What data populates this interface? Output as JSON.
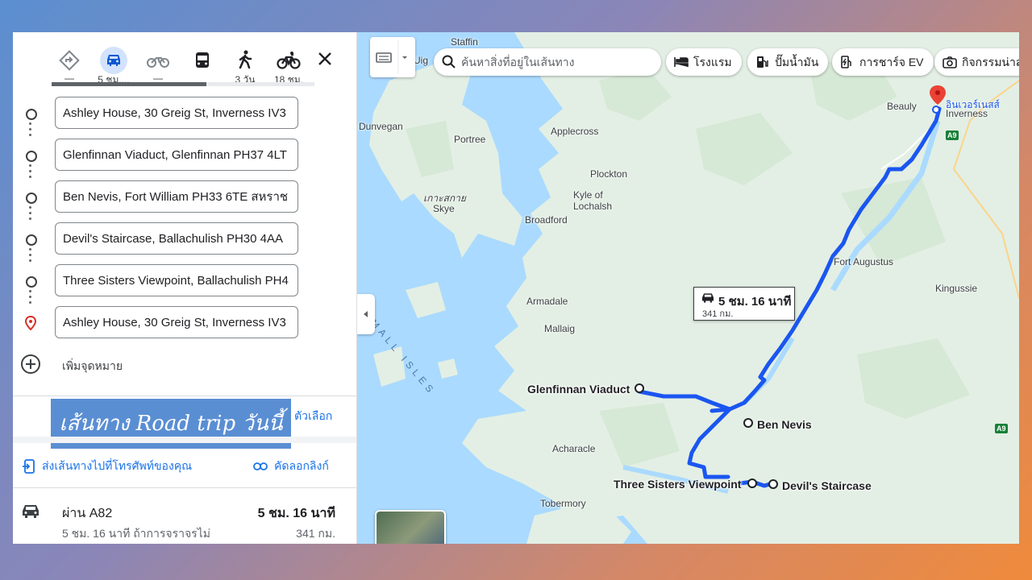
{
  "modes": [
    {
      "name": "best",
      "label": "—",
      "icon": "directions-icon"
    },
    {
      "name": "driving",
      "label": "5 ชม....",
      "icon": "car-icon",
      "active": true
    },
    {
      "name": "motorcycle",
      "label": "—",
      "icon": "motorcycle-icon"
    },
    {
      "name": "transit",
      "label": "",
      "icon": "bus-icon"
    },
    {
      "name": "walking",
      "label": "3 วัน",
      "icon": "walk-icon"
    },
    {
      "name": "cycling",
      "label": "18 ชม.",
      "icon": "bicycle-icon"
    }
  ],
  "stops": [
    "Ashley House, 30 Greig St, Inverness IV3",
    "Glenfinnan Viaduct, Glenfinnan PH37 4LT",
    "Ben Nevis, Fort William PH33 6TE สหราช",
    "Devil's Staircase, Ballachulish PH30 4AA",
    "Three Sisters Viewpoint, Ballachulish PH4",
    "Ashley House, 30 Greig St, Inverness IV3"
  ],
  "add_destination": "เพิ่มจุดหมาย",
  "options_label": "ตัวเลือก",
  "overlay_label": "เส้นทาง Road trip วันนี้",
  "send_to_phone": "ส่งเส้นทางไปที่โทรศัพท์ของคุณ",
  "copy_link": "คัดลอกลิงก์",
  "route": {
    "via": "ผ่าน A82",
    "time": "5 ชม. 16 นาที",
    "desc": "5 ชม. 16 นาที ถ้าการจราจรไม่",
    "distance": "341 กม."
  },
  "map": {
    "search_placeholder": "ค้นหาสิ่งที่อยู่ในเส้นทาง",
    "chips": [
      "โรงแรม",
      "ปั๊มน้ำมัน",
      "การชาร์จ EV",
      "กิจกรรมน่าส"
    ],
    "callout_time": "5 ชม. 16 นาที",
    "callout_dist": "341 กม.",
    "labels": {
      "staffin": "Staffin",
      "uig": "Uig",
      "dunvegan": "Dunvegan",
      "applecross": "Applecross",
      "portree": "Portree",
      "plockton": "Plockton",
      "skye_th": "เกาะสกาย",
      "skye": "Skye",
      "kyle1": "Kyle of",
      "kyle2": "Lochalsh",
      "broadford": "Broadford",
      "beauly": "Beauly",
      "inverness_th": "อินเวอร์เนสส์",
      "inverness": "Inverness",
      "fort_augustus": "Fort Augustus",
      "kingussie": "Kingussie",
      "armadale": "Armadale",
      "mallaig": "Mallaig",
      "acharacle": "Acharacle",
      "tobermory": "Tobermory",
      "small_isles": "SMALL ISLES"
    },
    "roads": [
      "A9",
      "A9"
    ],
    "pois": {
      "glenfinnan": "Glenfinnan Viaduct",
      "ben_nevis": "Ben Nevis",
      "three_sisters": "Three Sisters Viewpoint",
      "devils": "Devil's Staircase"
    },
    "route_color": "#1a56f0"
  }
}
